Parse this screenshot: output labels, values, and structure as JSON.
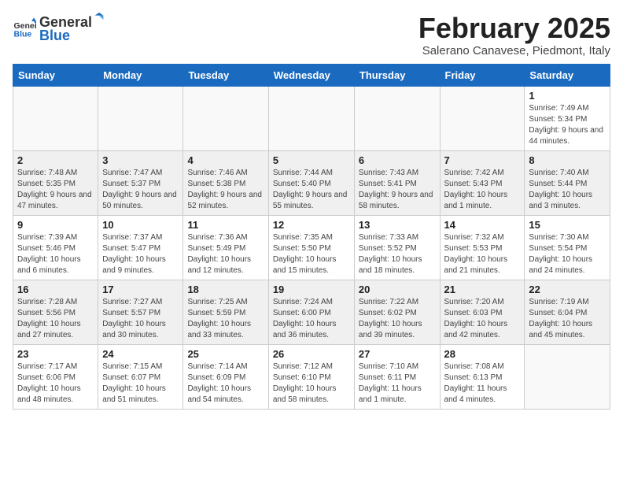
{
  "logo": {
    "text_general": "General",
    "text_blue": "Blue"
  },
  "header": {
    "month": "February 2025",
    "location": "Salerano Canavese, Piedmont, Italy"
  },
  "weekdays": [
    "Sunday",
    "Monday",
    "Tuesday",
    "Wednesday",
    "Thursday",
    "Friday",
    "Saturday"
  ],
  "weeks": [
    [
      {
        "day": "",
        "info": ""
      },
      {
        "day": "",
        "info": ""
      },
      {
        "day": "",
        "info": ""
      },
      {
        "day": "",
        "info": ""
      },
      {
        "day": "",
        "info": ""
      },
      {
        "day": "",
        "info": ""
      },
      {
        "day": "1",
        "info": "Sunrise: 7:49 AM\nSunset: 5:34 PM\nDaylight: 9 hours and 44 minutes."
      }
    ],
    [
      {
        "day": "2",
        "info": "Sunrise: 7:48 AM\nSunset: 5:35 PM\nDaylight: 9 hours and 47 minutes."
      },
      {
        "day": "3",
        "info": "Sunrise: 7:47 AM\nSunset: 5:37 PM\nDaylight: 9 hours and 50 minutes."
      },
      {
        "day": "4",
        "info": "Sunrise: 7:46 AM\nSunset: 5:38 PM\nDaylight: 9 hours and 52 minutes."
      },
      {
        "day": "5",
        "info": "Sunrise: 7:44 AM\nSunset: 5:40 PM\nDaylight: 9 hours and 55 minutes."
      },
      {
        "day": "6",
        "info": "Sunrise: 7:43 AM\nSunset: 5:41 PM\nDaylight: 9 hours and 58 minutes."
      },
      {
        "day": "7",
        "info": "Sunrise: 7:42 AM\nSunset: 5:43 PM\nDaylight: 10 hours and 1 minute."
      },
      {
        "day": "8",
        "info": "Sunrise: 7:40 AM\nSunset: 5:44 PM\nDaylight: 10 hours and 3 minutes."
      }
    ],
    [
      {
        "day": "9",
        "info": "Sunrise: 7:39 AM\nSunset: 5:46 PM\nDaylight: 10 hours and 6 minutes."
      },
      {
        "day": "10",
        "info": "Sunrise: 7:37 AM\nSunset: 5:47 PM\nDaylight: 10 hours and 9 minutes."
      },
      {
        "day": "11",
        "info": "Sunrise: 7:36 AM\nSunset: 5:49 PM\nDaylight: 10 hours and 12 minutes."
      },
      {
        "day": "12",
        "info": "Sunrise: 7:35 AM\nSunset: 5:50 PM\nDaylight: 10 hours and 15 minutes."
      },
      {
        "day": "13",
        "info": "Sunrise: 7:33 AM\nSunset: 5:52 PM\nDaylight: 10 hours and 18 minutes."
      },
      {
        "day": "14",
        "info": "Sunrise: 7:32 AM\nSunset: 5:53 PM\nDaylight: 10 hours and 21 minutes."
      },
      {
        "day": "15",
        "info": "Sunrise: 7:30 AM\nSunset: 5:54 PM\nDaylight: 10 hours and 24 minutes."
      }
    ],
    [
      {
        "day": "16",
        "info": "Sunrise: 7:28 AM\nSunset: 5:56 PM\nDaylight: 10 hours and 27 minutes."
      },
      {
        "day": "17",
        "info": "Sunrise: 7:27 AM\nSunset: 5:57 PM\nDaylight: 10 hours and 30 minutes."
      },
      {
        "day": "18",
        "info": "Sunrise: 7:25 AM\nSunset: 5:59 PM\nDaylight: 10 hours and 33 minutes."
      },
      {
        "day": "19",
        "info": "Sunrise: 7:24 AM\nSunset: 6:00 PM\nDaylight: 10 hours and 36 minutes."
      },
      {
        "day": "20",
        "info": "Sunrise: 7:22 AM\nSunset: 6:02 PM\nDaylight: 10 hours and 39 minutes."
      },
      {
        "day": "21",
        "info": "Sunrise: 7:20 AM\nSunset: 6:03 PM\nDaylight: 10 hours and 42 minutes."
      },
      {
        "day": "22",
        "info": "Sunrise: 7:19 AM\nSunset: 6:04 PM\nDaylight: 10 hours and 45 minutes."
      }
    ],
    [
      {
        "day": "23",
        "info": "Sunrise: 7:17 AM\nSunset: 6:06 PM\nDaylight: 10 hours and 48 minutes."
      },
      {
        "day": "24",
        "info": "Sunrise: 7:15 AM\nSunset: 6:07 PM\nDaylight: 10 hours and 51 minutes."
      },
      {
        "day": "25",
        "info": "Sunrise: 7:14 AM\nSunset: 6:09 PM\nDaylight: 10 hours and 54 minutes."
      },
      {
        "day": "26",
        "info": "Sunrise: 7:12 AM\nSunset: 6:10 PM\nDaylight: 10 hours and 58 minutes."
      },
      {
        "day": "27",
        "info": "Sunrise: 7:10 AM\nSunset: 6:11 PM\nDaylight: 11 hours and 1 minute."
      },
      {
        "day": "28",
        "info": "Sunrise: 7:08 AM\nSunset: 6:13 PM\nDaylight: 11 hours and 4 minutes."
      },
      {
        "day": "",
        "info": ""
      }
    ]
  ]
}
